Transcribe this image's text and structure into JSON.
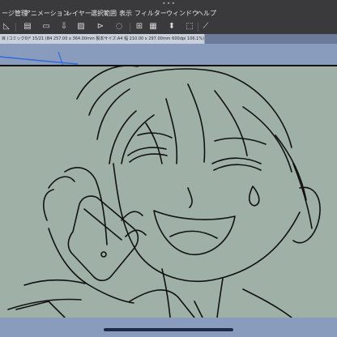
{
  "window": {
    "dots": "•••"
  },
  "menu": {
    "items": [
      {
        "id": "page",
        "label": "ージ管理"
      },
      {
        "id": "animation",
        "label": "アニメーション"
      },
      {
        "id": "layer",
        "label": "レイヤー"
      },
      {
        "id": "selection",
        "label": "選択範囲"
      },
      {
        "id": "view",
        "label": "表示"
      },
      {
        "id": "filter",
        "label": "フィルター"
      },
      {
        "id": "window",
        "label": "ウィンドウ"
      },
      {
        "id": "help",
        "label": "ヘルプ"
      }
    ]
  },
  "toolbar": {
    "icons": [
      "layer-icon",
      "page-icon",
      "export-icon",
      "import-icon",
      "transform-icon",
      "flip-icon",
      "rotate-icon",
      "grid-icon",
      "fill-icon",
      "arrows-icon",
      "select-icon",
      "ruler-icon"
    ]
  },
  "document": {
    "tab_title": "目 (コミック0)* 15/21 (B4 257.00 x 364.00mm 製本サイズ:A4 幅 210.00 x 297.00mm 600dpi 106.1%)"
  },
  "colors": {
    "menubar_bg": "#3a3a3c",
    "canvas_bg": "#8a9cbd",
    "panel_fill": "#9fb0a6",
    "line_color": "#111111",
    "accent_blue": "#2f6bd9"
  }
}
